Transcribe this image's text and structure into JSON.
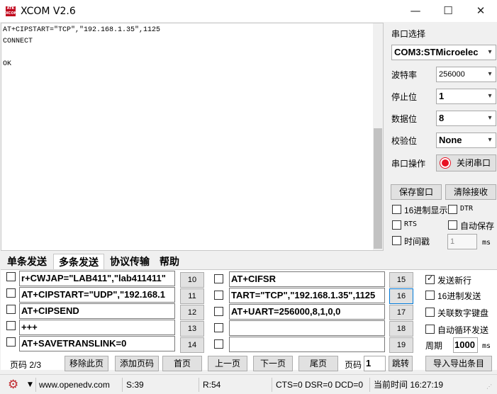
{
  "window": {
    "logo_text": "ATK XCOM",
    "title": "XCOM V2.6",
    "minimize_glyph": "—",
    "maximize_glyph": "☐",
    "close_glyph": "✕"
  },
  "receive": {
    "lines": [
      "AT+CIPSTART=\"TCP\",\"192.168.1.35\",1125",
      "CONNECT",
      "",
      "OK"
    ]
  },
  "serial": {
    "port_label": "串口选择",
    "port_value": "COM3:STMicroelec",
    "baud_label": "波特率",
    "baud_value": "256000",
    "stop_label": "停止位",
    "stop_value": "1",
    "data_label": "数据位",
    "data_value": "8",
    "parity_label": "校验位",
    "parity_value": "None",
    "op_label": "串口操作",
    "op_button": "关闭串口",
    "save_window": "保存窗口",
    "clear_receive": "清除接收",
    "hex_display": "16进制显示",
    "dtr": "DTR",
    "rts": "RTS",
    "auto_save": "自动保存",
    "timestamp": "时间戳",
    "timestamp_value": "1",
    "timestamp_unit": "ms"
  },
  "tabs": [
    "单条发送",
    "多条发送",
    "协议传输",
    "帮助"
  ],
  "multi_send": {
    "left": [
      {
        "text": "r+CWJAP=\"LAB411\",\"lab411411\"",
        "num": "10"
      },
      {
        "text": "AT+CIPSTART=\"UDP\",\"192.168.1",
        "num": "11"
      },
      {
        "text": "AT+CIPSEND",
        "num": "12"
      },
      {
        "text": "+++",
        "num": "13"
      },
      {
        "text": "AT+SAVETRANSLINK=0",
        "num": "14"
      }
    ],
    "right": [
      {
        "text": "AT+CIFSR",
        "num": "15"
      },
      {
        "text": "TART=\"TCP\",\"192.168.1.35\",1125",
        "num": "16"
      },
      {
        "text": "AT+UART=256000,8,1,0,0",
        "num": "17"
      },
      {
        "text": "",
        "num": "18"
      },
      {
        "text": "",
        "num": "19"
      }
    ],
    "send_newline": "发送新行",
    "hex_send": "16进制发送",
    "link_keypad": "关联数字键盘",
    "auto_loop": "自动循环发送",
    "period_label": "周期",
    "period_value": "1000",
    "period_unit": "ms",
    "page_label": "页码 2/3",
    "remove_page": "移除此页",
    "add_page": "添加页码",
    "first_page": "首页",
    "prev_page": "上一页",
    "next_page": "下一页",
    "last_page": "尾页",
    "goto_label": "页码",
    "goto_value": "1",
    "jump": "跳转",
    "import_export": "导入导出条目"
  },
  "status": {
    "url": "www.openedv.com",
    "sent": "S:39",
    "received": "R:54",
    "signals": "CTS=0 DSR=0 DCD=0",
    "time": "当前时间 16:27:19"
  },
  "colors": {
    "logo_red": "#c0001a",
    "radio_red": "#e81123",
    "focus_blue": "#0078d7"
  }
}
